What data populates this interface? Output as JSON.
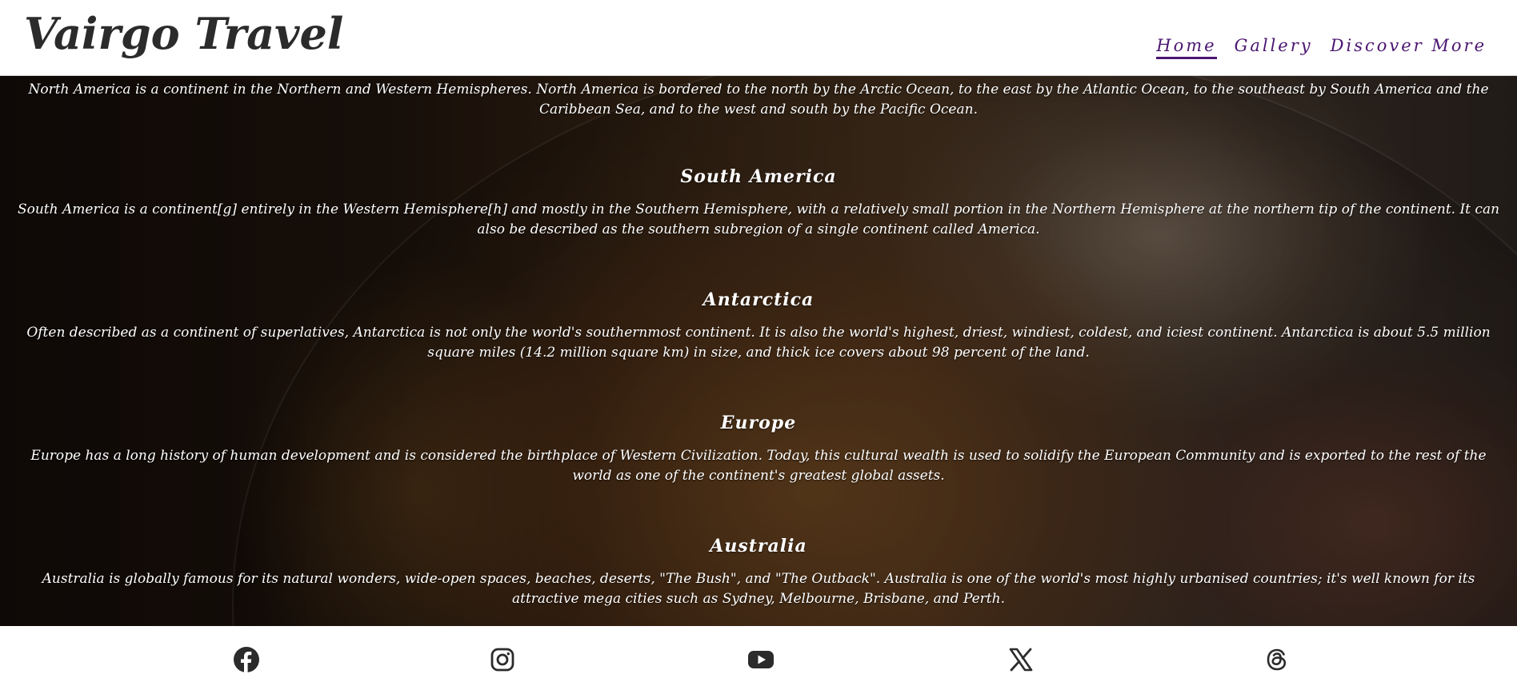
{
  "header": {
    "logo": "Vairgo Travel",
    "nav": [
      {
        "label": "Home",
        "active": true
      },
      {
        "label": "Gallery",
        "active": false
      },
      {
        "label": "Discover More",
        "active": false
      }
    ]
  },
  "colors": {
    "nav_link": "#4a1570",
    "logo": "#2b2b2b",
    "content_text": "#ffffff"
  },
  "sections": [
    {
      "title": "",
      "text": "North America is a continent in the Northern and Western Hemispheres. North America is bordered to the north by the Arctic Ocean, to the east by the Atlantic Ocean, to the southeast by South America and the Caribbean Sea, and to the west and south by the Pacific Ocean."
    },
    {
      "title": "South America",
      "text": "South America is a continent[g] entirely in the Western Hemisphere[h] and mostly in the Southern Hemisphere, with a relatively small portion in the Northern Hemisphere at the northern tip of the continent. It can also be described as the southern subregion of a single continent called America."
    },
    {
      "title": "Antarctica",
      "text": "Often described as a continent of superlatives, Antarctica is not only the world's southernmost continent. It is also the world's highest, driest, windiest, coldest, and iciest continent. Antarctica is about 5.5 million square miles (14.2 million square km) in size, and thick ice covers about 98 percent of the land."
    },
    {
      "title": "Europe",
      "text": "Europe has a long history of human development and is considered the birthplace of Western Civilization. Today, this cultural wealth is used to solidify the European Community and is exported to the rest of the world as one of the continent's greatest global assets."
    },
    {
      "title": "Australia",
      "text": "Australia is globally famous for its natural wonders, wide-open spaces, beaches, deserts, \"The Bush\", and \"The Outback\". Australia is one of the world's most highly urbanised countries; it's well known for its attractive mega cities such as Sydney, Melbourne, Brisbane, and Perth."
    }
  ],
  "footer": {
    "social_icons": [
      "facebook-icon",
      "instagram-icon",
      "youtube-icon",
      "x-icon",
      "threads-icon"
    ]
  }
}
